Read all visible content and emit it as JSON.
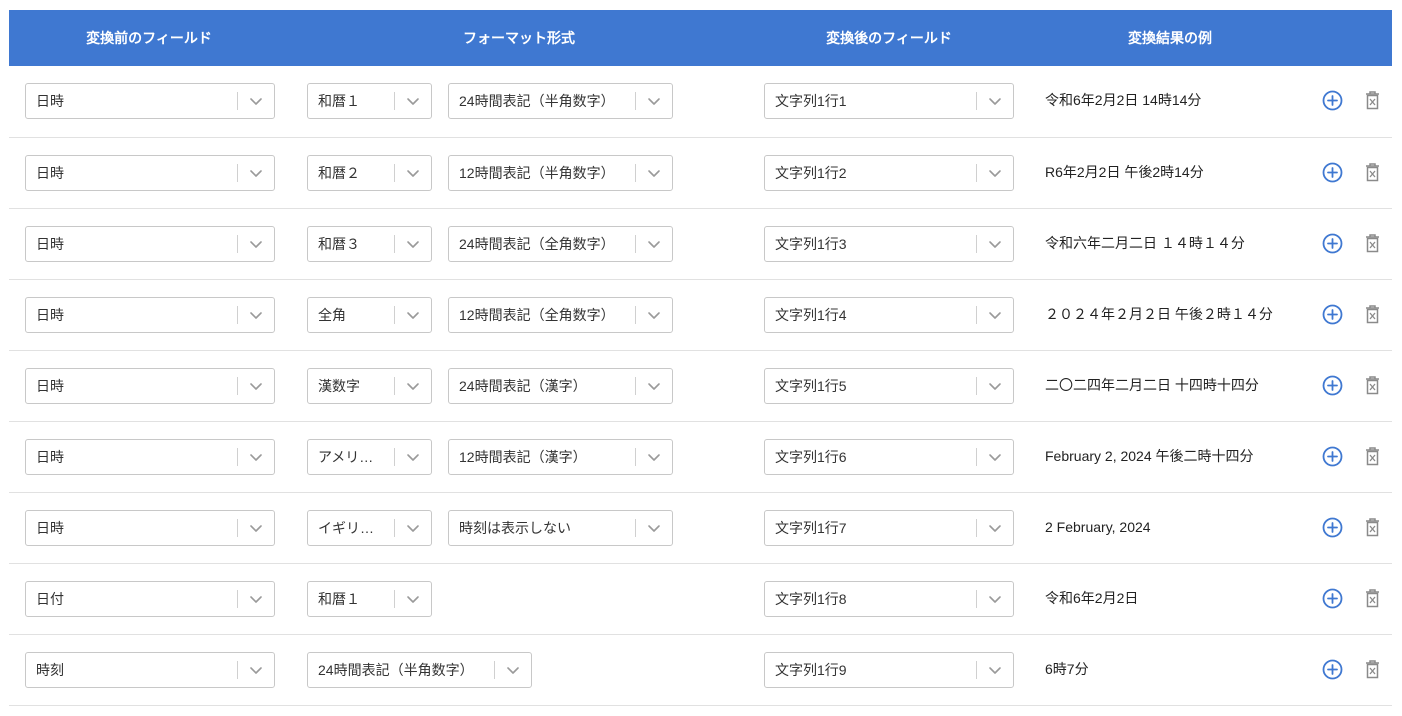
{
  "header": {
    "col_before": "変換前のフィールド",
    "col_format": "フォーマット形式",
    "col_after": "変換後のフィールド",
    "col_example": "変換結果の例"
  },
  "icons": {
    "chevron": "chevron-down-icon",
    "add": "plus-circle-icon",
    "delete": "trash-icon"
  },
  "colors": {
    "header_bg": "#3f78d1",
    "add_icon": "#3f78d1",
    "delete_icon": "#8a8a8a"
  },
  "rows": [
    {
      "source": "日時",
      "format1": "和暦１",
      "format2": "24時間表記（半角数字）",
      "target": "文字列1行1",
      "example": "令和6年2月2日 14時14分"
    },
    {
      "source": "日時",
      "format1": "和暦２",
      "format2": "12時間表記（半角数字）",
      "target": "文字列1行2",
      "example": "R6年2月2日 午後2時14分"
    },
    {
      "source": "日時",
      "format1": "和暦３",
      "format2": "24時間表記（全角数字）",
      "target": "文字列1行3",
      "example": "令和六年二月二日 １４時１４分"
    },
    {
      "source": "日時",
      "format1": "全角",
      "format2": "12時間表記（全角数字）",
      "target": "文字列1行4",
      "example": "２０２４年２月２日 午後２時１４分"
    },
    {
      "source": "日時",
      "format1": "漢数字",
      "format2": "24時間表記（漢字）",
      "target": "文字列1行5",
      "example": "二〇二四年二月二日 十四時十四分"
    },
    {
      "source": "日時",
      "format1": "アメリ…",
      "format2": "12時間表記（漢字）",
      "target": "文字列1行6",
      "example": "February 2, 2024 午後二時十四分"
    },
    {
      "source": "日時",
      "format1": "イギリ…",
      "format2": "時刻は表示しない",
      "target": "文字列1行7",
      "example": "2 February, 2024"
    },
    {
      "source": "日付",
      "format1": "和暦１",
      "target": "文字列1行8",
      "example": "令和6年2月2日"
    },
    {
      "source": "時刻",
      "format1": "24時間表記（半角数字）",
      "target": "文字列1行9",
      "example": "6時7分"
    }
  ]
}
